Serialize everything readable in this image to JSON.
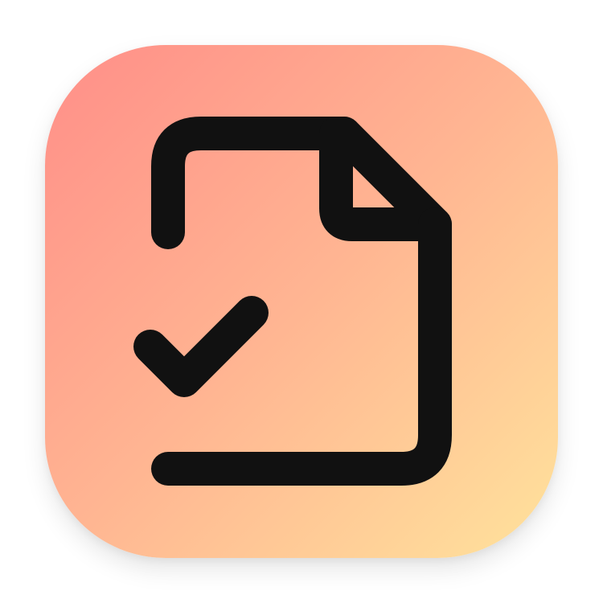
{
  "icon": {
    "name": "file-check-icon",
    "colors": {
      "gradient_start": "#ff8e88",
      "gradient_mid": "#ffb592",
      "gradient_end": "#ffe39c",
      "stroke": "#111111"
    }
  }
}
